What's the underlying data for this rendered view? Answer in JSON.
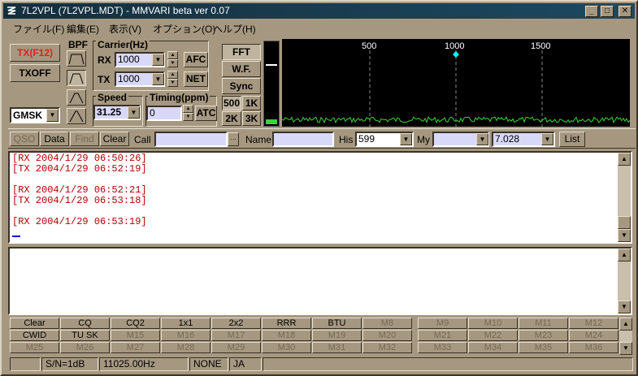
{
  "title": "7L2VPL (7L2VPL.MDT) - MMVARI beta ver 0.07",
  "menus": [
    "ファイル(F)",
    "編集(E)",
    "表示(V)",
    "オプション(O)",
    "ヘルプ(H)"
  ],
  "tx": {
    "tx_label": "TX(F12)",
    "txoff_label": "TXOFF",
    "mode": "GMSK"
  },
  "bpf": {
    "label": "BPF"
  },
  "carrier": {
    "label": "Carrier(Hz)",
    "rx_label": "RX",
    "rx_value": "1000",
    "tx_label": "TX",
    "tx_value": "1000",
    "afc_label": "AFC",
    "net_label": "NET"
  },
  "speed": {
    "label": "Speed",
    "value": "31.25"
  },
  "timing": {
    "label": "Timing(ppm)",
    "value": "0",
    "atc_label": "ATC"
  },
  "view": {
    "fft": "FFT",
    "wf": "W.F.",
    "sync": "Sync",
    "span": [
      "500",
      "1K",
      "2K",
      "3K"
    ]
  },
  "spectrum": {
    "ticks": [
      "500",
      "1000",
      "1500"
    ],
    "accent": "#00ffff",
    "trace_color": "#3cd23c"
  },
  "qso_bar": {
    "qso": "QSO",
    "data": "Data",
    "find": "Find",
    "clear": "Clear",
    "call_label": "Call",
    "call_value": "",
    "name_label": "Name",
    "name_value": "",
    "his_label": "His",
    "his_value": "599",
    "my_label": "My",
    "my_value": "",
    "freq_value": "7.028",
    "list_label": "List"
  },
  "rx_log": [
    "[RX 2004/1/29 06:50:26]",
    "[TX 2004/1/29 06:52:19]",
    "",
    "[RX 2004/1/29 06:52:21]",
    "[TX 2004/1/29 06:53:18]",
    "",
    "[RX 2004/1/29 06:53:19]"
  ],
  "macros_left": [
    [
      "Clear",
      "CQ",
      "CQ2",
      "1x1",
      "2x2",
      "RRR",
      "BTU",
      "M8"
    ],
    [
      "CWID",
      "TU SK",
      "M15",
      "M16",
      "M17",
      "M18",
      "M19",
      "M20"
    ],
    [
      "M25",
      "M26",
      "M27",
      "M28",
      "M29",
      "M30",
      "M31",
      "M32"
    ]
  ],
  "macros_right": [
    [
      "M9",
      "M10",
      "M11",
      "M12"
    ],
    [
      "M21",
      "M22",
      "M23",
      "M24"
    ],
    [
      "M33",
      "M34",
      "M35",
      "M36"
    ]
  ],
  "status": {
    "sn": "S/N=1dB",
    "clock": "11025.00Hz",
    "mode": "NONE",
    "lang": "JA"
  }
}
